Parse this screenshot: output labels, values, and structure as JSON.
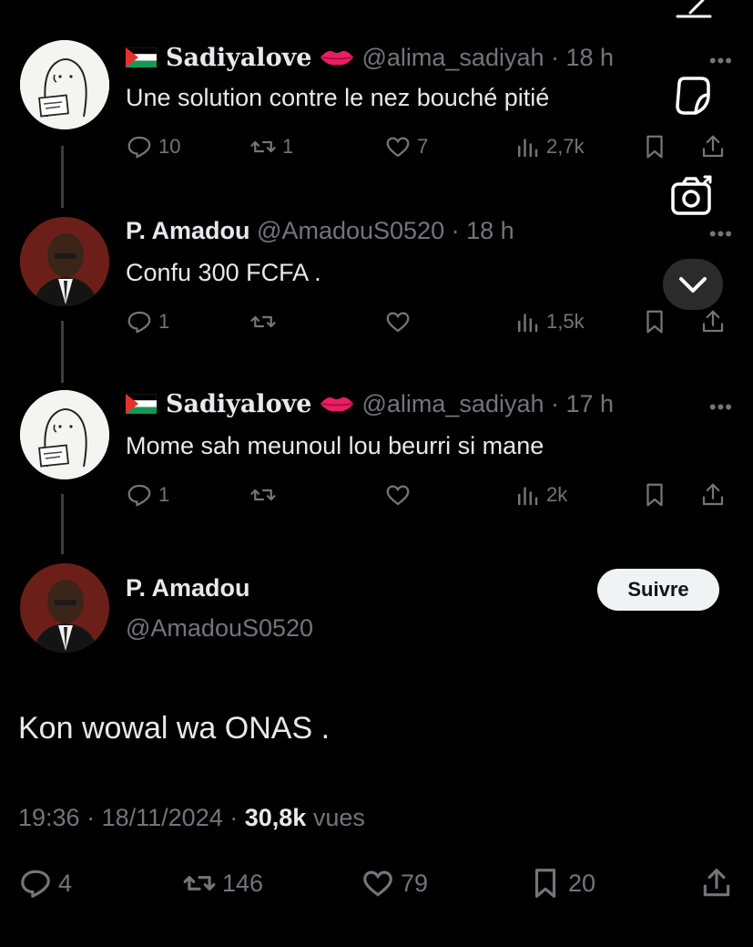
{
  "tweets": [
    {
      "name": "Sadiyalove",
      "handle": "@alima_sadiyah",
      "time": "· 18 h",
      "text": "Une solution contre le nez bouché pitié",
      "replies": "10",
      "retweets": "1",
      "likes": "7",
      "views": "2,7k"
    },
    {
      "name": "P. Amadou",
      "handle": "@AmadouS0520",
      "time": "· 18 h",
      "text": "Confu 300 FCFA .",
      "replies": "1",
      "retweets": "",
      "likes": "",
      "views": "1,5k"
    },
    {
      "name": "Sadiyalove",
      "handle": "@alima_sadiyah",
      "time": "· 17 h",
      "text": "Mome sah meunoul lou beurri si mane",
      "replies": "1",
      "retweets": "",
      "likes": "",
      "views": "2k"
    }
  ],
  "main": {
    "name": "P. Amadou",
    "handle": "@AmadouS0520",
    "follow_label": "Suivre",
    "text": "Kon wowal wa ONAS .",
    "time": "19:36",
    "date": "18/11/2024",
    "views_count": "30,8k",
    "views_label": "vues",
    "replies": "4",
    "retweets": "146",
    "likes": "79",
    "bookmarks": "20"
  },
  "more_label": "•••",
  "colors": {
    "bg": "#000000",
    "text": "#e7e9ea",
    "muted": "#71767b",
    "follow_bg": "#eff3f4"
  },
  "icons": [
    "reply-icon",
    "retweet-icon",
    "like-icon",
    "views-icon",
    "bookmark-icon",
    "share-icon",
    "edit-icon",
    "sticker-icon",
    "camera-icon",
    "chevron-down-icon"
  ]
}
